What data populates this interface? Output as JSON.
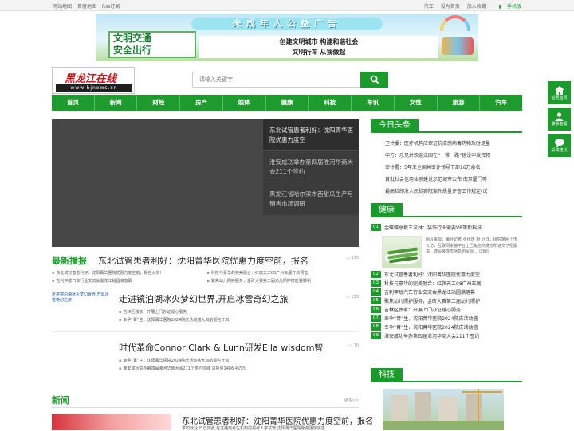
{
  "topbar": {
    "left_links": [
      "网站地图",
      "百度地图",
      "Rss订阅"
    ],
    "right_links": [
      "汽车",
      "设为首页",
      "加入收藏"
    ],
    "mobile": "手机版"
  },
  "banner": {
    "title": "未成年人公益广告",
    "slogan_line1": "文明交通",
    "slogan_line2": "安全出行",
    "strip_line1": "创建文明城市  构建和谐社会",
    "strip_line2": "文明行车  从我做起"
  },
  "logo": {
    "brand": "黑龙江在线",
    "url": "www.hjnews.cn"
  },
  "search": {
    "placeholder": "请输入关键字"
  },
  "nav": [
    "首页",
    "新闻",
    "财经",
    "房产",
    "娱体",
    "健康",
    "科技",
    "车讯",
    "女性",
    "旅游",
    "汽车"
  ],
  "slider": {
    "items": [
      "东北试管患者利好：沈阳菁华医院优惠力度空",
      "淮安成功举办第四届淮河华商大会211个签约",
      "黑龙江省哈尔滨市西甜瓜生产与销售市场调研"
    ]
  },
  "latest": {
    "label": "最新播报",
    "headline": "东北试管患者利好：沈阳菁华医院优惠力度空前，报名",
    "comments": "135",
    "links": [
      "东北试管患者利好：沈阳菁华医院优惠力度空前，报名火热!",
      "科技与豪华的完美融合：红旗天工08广州车展开启预售",
      "吉利甲醇汽车行业交流会黑龙江站圆满落幕",
      "聚焦幼儿照护服务，金砖大赛第二届幼儿照护技能赛顺利",
      "淮安成功举办第四届淮河华商大会211个签约项目 总投资1486.4亿元"
    ]
  },
  "story1": {
    "thumb_alt": "走进镜泊湖冰火梦幻世界,开启冰雪奇幻之旅",
    "title": "走进镜泊湖冰火梦幻世界,开启冰雪奇幻之旅",
    "comments": "120",
    "lines": [
      "吉林区独家：开展上门办证暖心服务",
      "幸孕“菁”生，沈阳菁华医院2024院庆活动盛大启航报名开启!"
    ]
  },
  "story2": {
    "title": "时代革命Connor,Clark & Lunn研发Ella wisdom智",
    "comments": "70",
    "lines": [
      "幸孕“菁”生，沈阳菁华医院2024院庆活动盛大启航报名开启!",
      "淮安成功举办第四届淮河华商大会211个签约项目 总投资1486.4亿元"
    ]
  },
  "news": {
    "label": "新闻",
    "more": "更多>>",
    "headline": "东北试管患者利好：沈阳菁华医院优惠力度空前，报名",
    "desc": "求职就业 日已如此 在这路愈考生机构的报考人学试管 沈阳菁华医院服务更加完善"
  },
  "sidebar": {
    "today_label": "今日头条",
    "today": [
      "卫计委：医疗机构应保证抗流感病毒药物及时足量",
      "中方：乐见并欢迎法国在“一带一路”建设中发挥积",
      "审计署：5年来全国共审计领导干部16万余名",
      "首批社会信用体系建设示范城市公布 南京厦门等",
      "最高检印发人民检察院案件质量评查工作规定(试"
    ],
    "health_label": "健康",
    "health_first": "金蝶蝶总裁王汉林：装饰行业需要VR等新科技",
    "featured_desc": "图片来源：每经记者 张扬庆 摄 近日，研究家网上市长访，互联网家装平台土巴兔也向港交所递交了招股书，建设装饰市场急剧呈现...[详细]",
    "health_ranked": [
      "东北试管患者利好：沈阳菁华医院优惠力度空",
      "科技与豪华的完美融合：红旗天工08广州车展",
      "吉利甲醇汽车行业交流会黑龙江站圆满落幕",
      "聚焦幼儿照护服务，金砖大赛第二届幼儿照护",
      "吉林区独家：开展上门办证暖心服务",
      "幸孕“菁”生，沈阳菁华医院2024院庆活动盛",
      "幸孕“菁”生，沈阳菁华医院2024院庆活动盛",
      "淮安成功举办第四届淮河华商大会211个签约"
    ],
    "tech_label": "科技"
  },
  "floaters": [
    "返回首页",
    "联系客服",
    "投稿建议"
  ]
}
